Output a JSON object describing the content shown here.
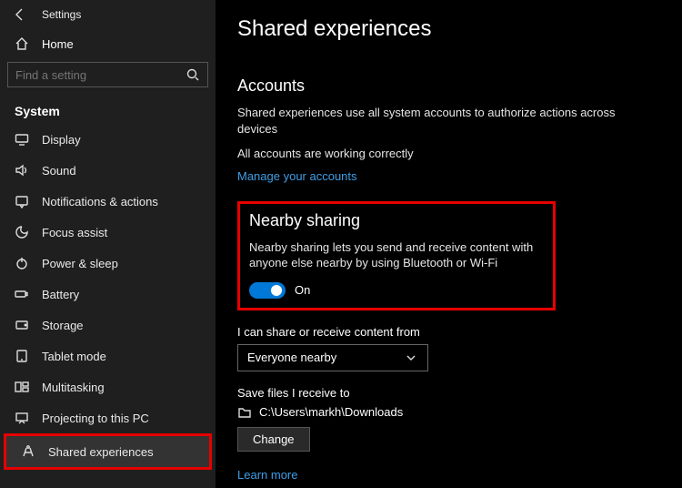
{
  "header": {
    "title": "Settings"
  },
  "home_label": "Home",
  "search": {
    "placeholder": "Find a setting"
  },
  "section_label": "System",
  "sidebar": {
    "items": [
      {
        "label": "Display"
      },
      {
        "label": "Sound"
      },
      {
        "label": "Notifications & actions"
      },
      {
        "label": "Focus assist"
      },
      {
        "label": "Power & sleep"
      },
      {
        "label": "Battery"
      },
      {
        "label": "Storage"
      },
      {
        "label": "Tablet mode"
      },
      {
        "label": "Multitasking"
      },
      {
        "label": "Projecting to this PC"
      },
      {
        "label": "Shared experiences"
      }
    ]
  },
  "page": {
    "title": "Shared experiences"
  },
  "accounts": {
    "title": "Accounts",
    "desc": "Shared experiences use all system accounts to authorize actions across devices",
    "status": "All accounts are working correctly",
    "manage_link": "Manage your accounts"
  },
  "nearby": {
    "title": "Nearby sharing",
    "desc": "Nearby sharing lets you send and receive content with anyone else nearby by using Bluetooth or Wi-Fi",
    "toggle_label": "On"
  },
  "share_from": {
    "label": "I can share or receive content from",
    "value": "Everyone nearby"
  },
  "save_to": {
    "label": "Save files I receive to",
    "path": "C:\\Users\\markh\\Downloads",
    "change_btn": "Change"
  },
  "learn_more": "Learn more"
}
